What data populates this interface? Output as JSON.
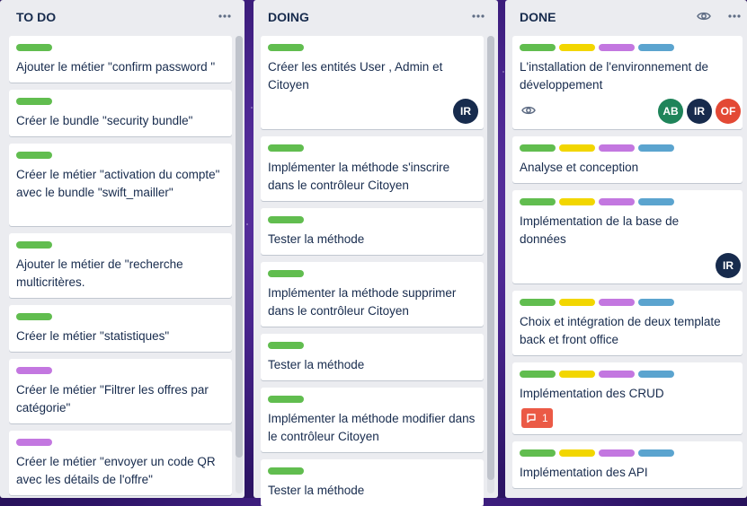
{
  "lists": {
    "todo": {
      "title": "TO DO",
      "cards": [
        {
          "text": "Ajouter le métier \"confirm password \""
        },
        {
          "text": "Créer le bundle \"security bundle\""
        },
        {
          "text": "Créer le métier \"activation du compte\" avec le bundle \"swift_mailler\""
        },
        {
          "text": "Ajouter le métier de \"recherche multicritères."
        },
        {
          "text": "Créer le métier \"statistiques\""
        },
        {
          "text": "Créer le métier \"Filtrer les offres par catégorie\""
        },
        {
          "text": "Créer le métier \"envoyer un code QR avec les détails de l'offre\""
        }
      ]
    },
    "doing": {
      "title": "DOING",
      "cards": [
        {
          "text": "Créer les entités User , Admin et Citoyen",
          "members": [
            "IR"
          ]
        },
        {
          "text": "Implémenter la méthode s'inscrire dans le contrôleur Citoyen"
        },
        {
          "text": "Tester la méthode"
        },
        {
          "text": "Implémenter la méthode supprimer dans le contrôleur Citoyen"
        },
        {
          "text": "Tester la méthode"
        },
        {
          "text": "Implémenter la méthode modifier dans le contrôleur Citoyen"
        },
        {
          "text": "Tester la méthode"
        }
      ]
    },
    "done": {
      "title": "DONE",
      "cards": [
        {
          "text": "L'installation de l'environnement de développement",
          "members": [
            "AB",
            "IR",
            "OF"
          ]
        },
        {
          "text": "Analyse et conception"
        },
        {
          "text": "Implémentation de la base de données",
          "members": [
            "IR"
          ]
        },
        {
          "text": "Choix et intégration de deux template back et front office"
        },
        {
          "text": "Implémentation des CRUD",
          "comments": "1"
        },
        {
          "text": "Implémentation des API"
        }
      ]
    }
  },
  "colors": {
    "label_green": "#61bd4f",
    "label_yellow": "#f2d600",
    "label_purple": "#c377e0",
    "label_blue": "#5ba4cf",
    "avatar_ab": "#1f845a",
    "avatar_ir": "#172b4d",
    "avatar_of": "#e34935"
  },
  "icons": [
    "more-icon",
    "eye-icon",
    "comment-icon"
  ]
}
